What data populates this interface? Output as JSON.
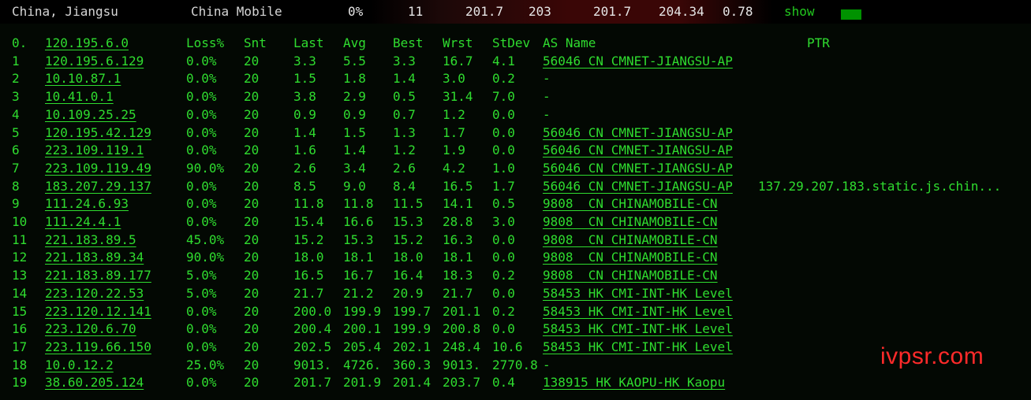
{
  "summary": {
    "location": "China, Jiangsu",
    "isp": "China Mobile",
    "loss": "0%",
    "hops": "11",
    "last": "201.7",
    "best": "203",
    "avg": "201.7",
    "worst": "204.34",
    "stdev": "0.78",
    "show_label": "show"
  },
  "header": {
    "idx": "0.",
    "host": "120.195.6.0",
    "loss": "Loss%",
    "snt": "Snt",
    "last": "Last",
    "avg": "Avg",
    "best": "Best",
    "wrst": "Wrst",
    "stdev": "StDev",
    "as_name": "AS Name",
    "ptr": "PTR"
  },
  "hops": [
    {
      "n": "1",
      "host": "120.195.6.129",
      "loss": "0.0%",
      "snt": "20",
      "last": "3.3",
      "avg": "5.5",
      "best": "3.3",
      "wrst": "16.7",
      "stdev": "4.1",
      "as": "56046 CN CMNET-JIANGSU-AP",
      "ptr": ""
    },
    {
      "n": "2",
      "host": "10.10.87.1",
      "loss": "0.0%",
      "snt": "20",
      "last": "1.5",
      "avg": "1.8",
      "best": "1.4",
      "wrst": "3.0",
      "stdev": "0.2",
      "as": "-",
      "ptr": ""
    },
    {
      "n": "3",
      "host": "10.41.0.1",
      "loss": "0.0%",
      "snt": "20",
      "last": "3.8",
      "avg": "2.9",
      "best": "0.5",
      "wrst": "31.4",
      "stdev": "7.0",
      "as": "-",
      "ptr": ""
    },
    {
      "n": "4",
      "host": "10.109.25.25",
      "loss": "0.0%",
      "snt": "20",
      "last": "0.9",
      "avg": "0.9",
      "best": "0.7",
      "wrst": "1.2",
      "stdev": "0.0",
      "as": "-",
      "ptr": ""
    },
    {
      "n": "5",
      "host": "120.195.42.129",
      "loss": "0.0%",
      "snt": "20",
      "last": "1.4",
      "avg": "1.5",
      "best": "1.3",
      "wrst": "1.7",
      "stdev": "0.0",
      "as": "56046 CN CMNET-JIANGSU-AP",
      "ptr": ""
    },
    {
      "n": "6",
      "host": "223.109.119.1",
      "loss": "0.0%",
      "snt": "20",
      "last": "1.6",
      "avg": "1.4",
      "best": "1.2",
      "wrst": "1.9",
      "stdev": "0.0",
      "as": "56046 CN CMNET-JIANGSU-AP",
      "ptr": ""
    },
    {
      "n": "7",
      "host": "223.109.119.49",
      "loss": "90.0%",
      "snt": "20",
      "last": "2.6",
      "avg": "3.4",
      "best": "2.6",
      "wrst": "4.2",
      "stdev": "1.0",
      "as": "56046 CN CMNET-JIANGSU-AP",
      "ptr": ""
    },
    {
      "n": "8",
      "host": "183.207.29.137",
      "loss": "0.0%",
      "snt": "20",
      "last": "8.5",
      "avg": "9.0",
      "best": "8.4",
      "wrst": "16.5",
      "stdev": "1.7",
      "as": "56046 CN CMNET-JIANGSU-AP",
      "ptr": "137.29.207.183.static.js.chin..."
    },
    {
      "n": "9",
      "host": "111.24.6.93",
      "loss": "0.0%",
      "snt": "20",
      "last": "11.8",
      "avg": "11.8",
      "best": "11.5",
      "wrst": "14.1",
      "stdev": "0.5",
      "as": "9808  CN CHINAMOBILE-CN",
      "ptr": ""
    },
    {
      "n": "10",
      "host": "111.24.4.1",
      "loss": "0.0%",
      "snt": "20",
      "last": "15.4",
      "avg": "16.6",
      "best": "15.3",
      "wrst": "28.8",
      "stdev": "3.0",
      "as": "9808  CN CHINAMOBILE-CN",
      "ptr": ""
    },
    {
      "n": "11",
      "host": "221.183.89.5",
      "loss": "45.0%",
      "snt": "20",
      "last": "15.2",
      "avg": "15.3",
      "best": "15.2",
      "wrst": "16.3",
      "stdev": "0.0",
      "as": "9808  CN CHINAMOBILE-CN",
      "ptr": ""
    },
    {
      "n": "12",
      "host": "221.183.89.34",
      "loss": "90.0%",
      "snt": "20",
      "last": "18.0",
      "avg": "18.1",
      "best": "18.0",
      "wrst": "18.1",
      "stdev": "0.0",
      "as": "9808  CN CHINAMOBILE-CN",
      "ptr": ""
    },
    {
      "n": "13",
      "host": "221.183.89.177",
      "loss": "5.0%",
      "snt": "20",
      "last": "16.5",
      "avg": "16.7",
      "best": "16.4",
      "wrst": "18.3",
      "stdev": "0.2",
      "as": "9808  CN CHINAMOBILE-CN",
      "ptr": ""
    },
    {
      "n": "14",
      "host": "223.120.22.53",
      "loss": "5.0%",
      "snt": "20",
      "last": "21.7",
      "avg": "21.2",
      "best": "20.9",
      "wrst": "21.7",
      "stdev": "0.0",
      "as": "58453 HK CMI-INT-HK Level",
      "ptr": ""
    },
    {
      "n": "15",
      "host": "223.120.12.141",
      "loss": "0.0%",
      "snt": "20",
      "last": "200.0",
      "avg": "199.9",
      "best": "199.7",
      "wrst": "201.1",
      "stdev": "0.2",
      "as": "58453 HK CMI-INT-HK Level",
      "ptr": ""
    },
    {
      "n": "16",
      "host": "223.120.6.70",
      "loss": "0.0%",
      "snt": "20",
      "last": "200.4",
      "avg": "200.1",
      "best": "199.9",
      "wrst": "200.8",
      "stdev": "0.0",
      "as": "58453 HK CMI-INT-HK Level",
      "ptr": ""
    },
    {
      "n": "17",
      "host": "223.119.66.150",
      "loss": "0.0%",
      "snt": "20",
      "last": "202.5",
      "avg": "205.4",
      "best": "202.1",
      "wrst": "248.4",
      "stdev": "10.6",
      "as": "58453 HK CMI-INT-HK Level",
      "ptr": ""
    },
    {
      "n": "18",
      "host": "10.0.12.2",
      "loss": "25.0%",
      "snt": "20",
      "last": "9013.",
      "avg": "4726.",
      "best": "360.3",
      "wrst": "9013.",
      "stdev": "2770.8",
      "as": "-",
      "ptr": ""
    },
    {
      "n": "19",
      "host": "38.60.205.124",
      "loss": "0.0%",
      "snt": "20",
      "last": "201.7",
      "avg": "201.9",
      "best": "201.4",
      "wrst": "203.7",
      "stdev": "0.4",
      "as": "138915 HK KAOPU-HK Kaopu",
      "ptr": ""
    }
  ],
  "watermark": "ivpsr.com",
  "colors": {
    "terminal_green": "#2fdc2f",
    "summary_text": "#d6d6d6",
    "show_link": "#22c81e",
    "status_bar": "#009200",
    "watermark": "#ff2a2a",
    "background": "#030803"
  }
}
